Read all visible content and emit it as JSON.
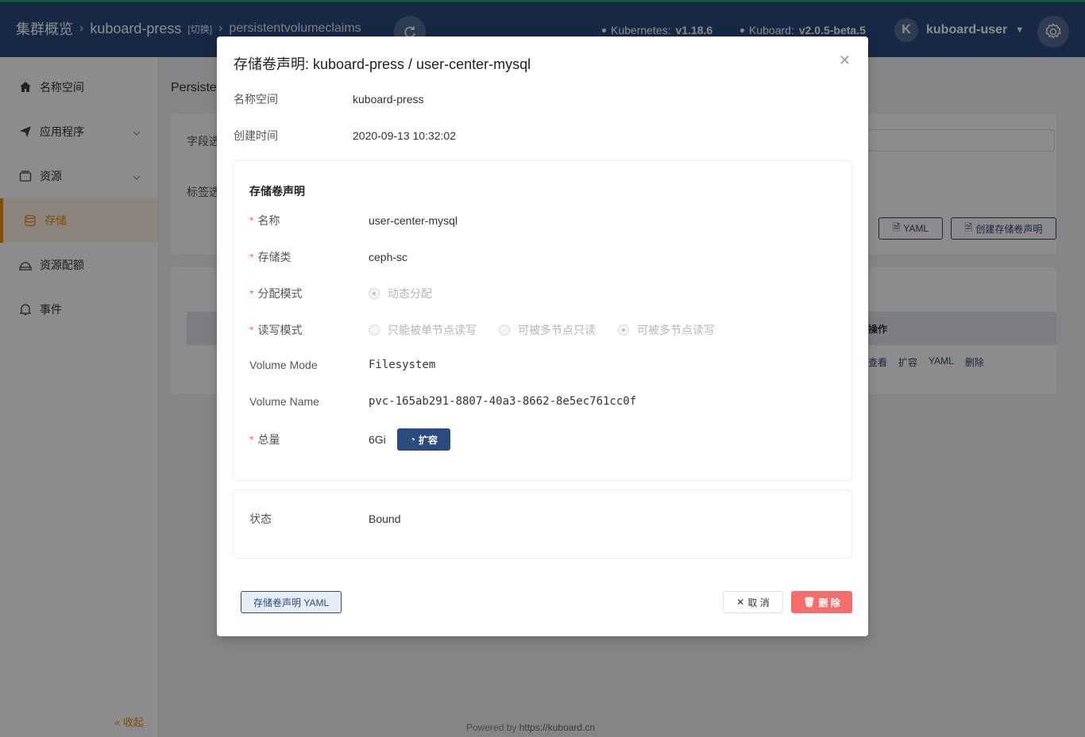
{
  "header": {
    "cluster": "集群概览",
    "namespace": "kuboard-press",
    "switch": "[切换]",
    "resource": "persistentvolumeclaims",
    "k8s_label": "Kubernetes:",
    "k8s_version": "v1.18.6",
    "kuboard_label": "Kuboard:",
    "kuboard_version": "v2.0.5-beta.5",
    "avatar": "K",
    "username": "kuboard-user"
  },
  "sidebar": {
    "items": [
      {
        "label": "名称空间"
      },
      {
        "label": "应用程序"
      },
      {
        "label": "资源"
      },
      {
        "label": "存储"
      },
      {
        "label": "资源配额"
      },
      {
        "label": "事件"
      }
    ],
    "collapse": "« 收起"
  },
  "background": {
    "page_title": "Persiste",
    "filter_field": "字段选",
    "filter_label": "标签选",
    "yaml_btn": "YAML",
    "create_btn": "创建存储卷声明",
    "op_header": "操作",
    "ops": [
      "查看",
      "扩容",
      "YAML",
      "删除"
    ]
  },
  "footer": {
    "prefix": "Powered by",
    "link": "https://kuboard.cn"
  },
  "modal": {
    "title": "存储卷声明: kuboard-press / user-center-mysql",
    "namespace_label": "名称空间",
    "namespace_value": "kuboard-press",
    "created_label": "创建时间",
    "created_value": "2020-09-13 10:32:02",
    "section_title": "存储卷声明",
    "fields": {
      "name_label": "名称",
      "name_value": "user-center-mysql",
      "class_label": "存储类",
      "class_value": "ceph-sc",
      "alloc_label": "分配模式",
      "alloc_option": "动态分配",
      "rw_label": "读写模式",
      "rw_options": [
        "只能被单节点读写",
        "可被多节点只读",
        "可被多节点读写"
      ],
      "vmode_label": "Volume Mode",
      "vmode_value": "Filesystem",
      "vname_label": "Volume Name",
      "vname_value": "pvc-165ab291-8807-40a3-8662-8e5ec761cc0f",
      "size_label": "总量",
      "size_value": "6Gi",
      "expand_btn": "扩容"
    },
    "status_label": "状态",
    "status_value": "Bound",
    "yaml_btn": "存储卷声明 YAML",
    "cancel_btn": "取 消",
    "delete_btn": "删 除"
  }
}
